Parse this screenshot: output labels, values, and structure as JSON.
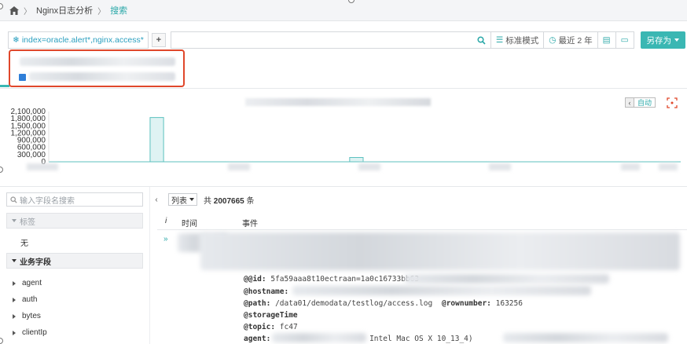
{
  "breadcrumb": {
    "items": [
      "Nginx日志分析",
      "搜索"
    ]
  },
  "search": {
    "query": "index=oracle.alert*,nginx.access*",
    "add_label": "+",
    "standard_mode": "标准模式",
    "time_range": "最近 2 年",
    "save_as": "另存为"
  },
  "timeline": {
    "auto_label": "自动"
  },
  "chart_data": {
    "type": "bar",
    "yticks": [
      "2,100,000",
      "1,800,000",
      "1,500,000",
      "1,200,000",
      "900,000",
      "600,000",
      "300,000",
      "0"
    ],
    "ylim": [
      0,
      2100000
    ],
    "grid": false,
    "bar_color": "#dff3f3",
    "bar_stroke": "#5cc1bf",
    "x": [
      0,
      1,
      2,
      3,
      4,
      5,
      6,
      7,
      8,
      9,
      10,
      11,
      12,
      13,
      14,
      15,
      16,
      17,
      18,
      19,
      20,
      21,
      22,
      23,
      24,
      25,
      26,
      27,
      28,
      29,
      30,
      31,
      32,
      33,
      34,
      35,
      36,
      37
    ],
    "values": [
      0,
      0,
      0,
      0,
      0,
      0,
      1850000,
      0,
      0,
      0,
      0,
      0,
      0,
      0,
      0,
      0,
      0,
      0,
      180000,
      0,
      0,
      0,
      0,
      0,
      0,
      0,
      0,
      0,
      0,
      0,
      0,
      0,
      0,
      0,
      0,
      0,
      0,
      0
    ]
  },
  "fields": {
    "search_placeholder": "输入字段名搜索",
    "tags_section": "标签",
    "none_label": "无",
    "business_section": "业务字段",
    "items": [
      "agent",
      "auth",
      "bytes",
      "clientIp"
    ]
  },
  "results": {
    "view_select": "列表",
    "total_prefix": "共",
    "total_count": "2007665",
    "total_suffix": "条",
    "col_info": "i",
    "col_time": "时间",
    "col_event": "事件",
    "expand_symbol": "»",
    "event": {
      "id_key": "@@id:",
      "id_val": "5fa59aaa8t10ectraan=1a0c16733bb63",
      "hostname_key": "@hostname:",
      "path_key": "@path:",
      "path_val": "/data01/demodata/testlog/access.log",
      "rownumber_key": "@rownumber:",
      "rownumber_val": "163256",
      "storage_key": "@storageTime",
      "topic_key": "@topic:",
      "topic_val": "fc47",
      "agent_key": "agent:",
      "agent_val": "Intel Mac OS X 10_13_4)"
    }
  }
}
